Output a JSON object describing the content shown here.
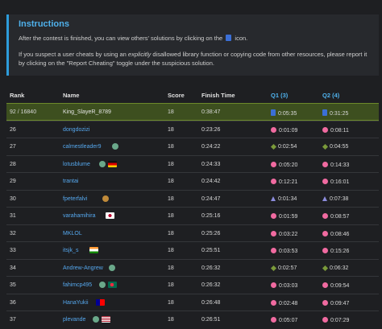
{
  "instructions": {
    "title": "Instructions",
    "p1_before": "After the contest is finished, you can view others' solutions by clicking on the",
    "p1_after": "icon.",
    "p2_a": "If you suspect a user cheats by using an",
    "p2_em": "explicitly",
    "p2_b": "disallowed library function or copying code from other resources, please report it by clicking on the \"Report Cheating\" toggle under the suspicious solution."
  },
  "table": {
    "headers": {
      "rank": "Rank",
      "name": "Name",
      "score": "Score",
      "finish_time": "Finish Time",
      "q1": "Q1 (3)",
      "q2": "Q2 (4)"
    },
    "rows": [
      {
        "rank": "92 / 16840",
        "name": "King_SlayeR_8789",
        "score": "18",
        "time": "0:38:47",
        "q1": "0:05:35",
        "q2": "0:31:25",
        "q1_icon": "doc",
        "q2_icon": "doc",
        "mine": true
      },
      {
        "rank": "26",
        "name": "dongdozizi",
        "score": "18",
        "time": "0:23:26",
        "q1": "0:01:09",
        "q2": "0:08:11",
        "q1_icon": "ok",
        "q2_icon": "ok"
      },
      {
        "rank": "27",
        "name": "calmestleader9",
        "score": "18",
        "time": "0:24:22",
        "q1": "0:02:54",
        "q2": "0:04:55",
        "q1_icon": "diamond",
        "q2_icon": "diamond",
        "badge_color": "#6aa88a"
      },
      {
        "rank": "28",
        "name": "lotusblume",
        "score": "18",
        "time": "0:24:33",
        "q1": "0:05:20",
        "q2": "0:14:33",
        "q1_icon": "ok",
        "q2_icon": "ok",
        "badge_color": "#6aa88a",
        "flag": "de"
      },
      {
        "rank": "29",
        "name": "trantai",
        "score": "18",
        "time": "0:24:42",
        "q1": "0:12:21",
        "q2": "0:16:01",
        "q1_icon": "ok",
        "q2_icon": "ok"
      },
      {
        "rank": "30",
        "name": "fpeterfalvi",
        "score": "18",
        "time": "0:24:47",
        "q1": "0:01:34",
        "q2": "0:07:38",
        "q1_icon": "tri",
        "q2_icon": "tri",
        "badge_color": "#c08a3a"
      },
      {
        "rank": "31",
        "name": "varahamihira",
        "score": "18",
        "time": "0:25:16",
        "q1": "0:01:59",
        "q2": "0:08:57",
        "q1_icon": "ok",
        "q2_icon": "ok",
        "flag": "jp"
      },
      {
        "rank": "32",
        "name": "MKLOL",
        "score": "18",
        "time": "0:25:26",
        "q1": "0:03:22",
        "q2": "0:08:46",
        "q1_icon": "ok",
        "q2_icon": "ok"
      },
      {
        "rank": "33",
        "name": "itsjk_s",
        "score": "18",
        "time": "0:25:51",
        "q1": "0:03:53",
        "q2": "0:15:26",
        "q1_icon": "ok",
        "q2_icon": "ok",
        "flag": "in"
      },
      {
        "rank": "34",
        "name": "Andrew-Angrew",
        "score": "18",
        "time": "0:26:32",
        "q1": "0:02:57",
        "q2": "0:06:32",
        "q1_icon": "diamond",
        "q2_icon": "diamond",
        "badge_color": "#6aa88a"
      },
      {
        "rank": "35",
        "name": "fahimcp495",
        "score": "18",
        "time": "0:26:32",
        "q1": "0:03:03",
        "q2": "0:09:54",
        "q1_icon": "ok",
        "q2_icon": "ok",
        "badge_color": "#6aa88a",
        "flag": "bd"
      },
      {
        "rank": "36",
        "name": "HanaYukii",
        "score": "18",
        "time": "0:26:48",
        "q1": "0:02:48",
        "q2": "0:09:47",
        "q1_icon": "ok",
        "q2_icon": "ok",
        "flag": "tw"
      },
      {
        "rank": "37",
        "name": "plevande",
        "score": "18",
        "time": "0:26:51",
        "q1": "0:05:07",
        "q2": "0:07:29",
        "q1_icon": "ok",
        "q2_icon": "ok",
        "badge_color": "#6aa88a",
        "flag": "us"
      }
    ]
  }
}
